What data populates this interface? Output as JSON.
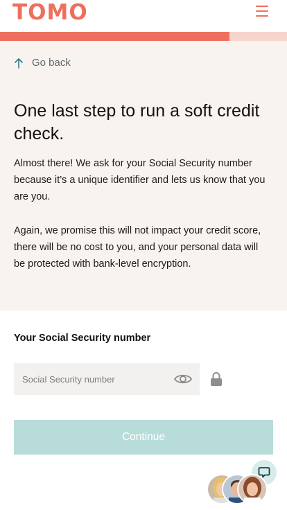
{
  "brand": {
    "logo_text": "TOMO",
    "accent_color": "#ef6f5e",
    "progress_track_color": "#f7d4cd"
  },
  "progress": {
    "fraction": 0.8
  },
  "nav": {
    "go_back_label": "Go back",
    "menu_icon": "hamburger-icon"
  },
  "hero": {
    "title": "One last step to run a soft credit check.",
    "paragraph_1": "Almost there! We ask for your Social Security number because it’s a unique identifier and lets us know that you are you.",
    "paragraph_2": "Again, we promise this will not impact your credit score, there will be no cost to you, and your personal data will be protected with bank-level encryption."
  },
  "form": {
    "ssn_label": "Your Social Security number",
    "ssn_placeholder": "Social Security number",
    "ssn_value": "",
    "continue_label": "Continue",
    "continue_color": "#b8dcda"
  },
  "support": {
    "chat_icon": "chat-bubble-icon",
    "agents_count": 3
  }
}
